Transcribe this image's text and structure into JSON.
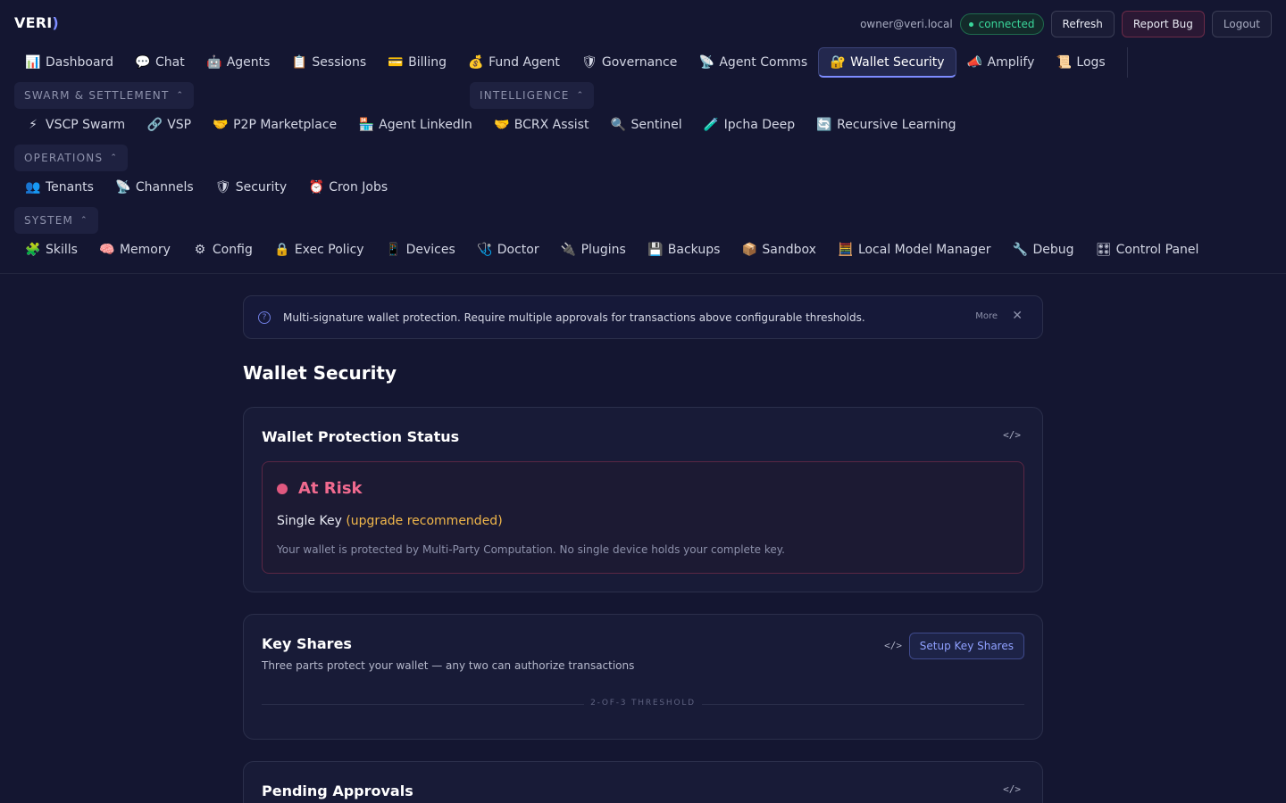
{
  "header": {
    "logo": "VERI",
    "logo_paren": ")",
    "user": "owner@veri.local",
    "status": "connected",
    "refresh_label": "Refresh",
    "report_bug_label": "Report Bug",
    "logout_label": "Logout"
  },
  "nav": {
    "main": [
      {
        "icon": "📊",
        "label": "Dashboard"
      },
      {
        "icon": "💬",
        "label": "Chat"
      },
      {
        "icon": "🤖",
        "label": "Agents"
      },
      {
        "icon": "📋",
        "label": "Sessions"
      },
      {
        "icon": "💳",
        "label": "Billing"
      },
      {
        "icon": "💰",
        "label": "Fund Agent"
      },
      {
        "icon": "🛡",
        "label": "Governance"
      },
      {
        "icon": "📡",
        "label": "Agent Comms"
      },
      {
        "icon": "🔐",
        "label": "Wallet Security"
      },
      {
        "icon": "📣",
        "label": "Amplify"
      },
      {
        "icon": "📜",
        "label": "Logs"
      }
    ],
    "active": "Wallet Security",
    "groups": {
      "swarm": "SWARM & SETTLEMENT",
      "intelligence": "INTELLIGENCE",
      "operations": "OPERATIONS",
      "system": "SYSTEM"
    },
    "swarm_intel": [
      {
        "icon": "⚡",
        "label": "VSCP Swarm"
      },
      {
        "icon": "🔗",
        "label": "VSP"
      },
      {
        "icon": "🤝",
        "label": "P2P Marketplace"
      },
      {
        "icon": "🏪",
        "label": "Agent LinkedIn"
      },
      {
        "icon": "🤝",
        "label": "BCRX Assist"
      },
      {
        "icon": "🔍",
        "label": "Sentinel"
      },
      {
        "icon": "🧪",
        "label": "Ipcha Deep"
      },
      {
        "icon": "🔄",
        "label": "Recursive Learning"
      }
    ],
    "operations": [
      {
        "icon": "👥",
        "label": "Tenants"
      },
      {
        "icon": "📡",
        "label": "Channels"
      },
      {
        "icon": "🛡",
        "label": "Security"
      },
      {
        "icon": "⏰",
        "label": "Cron Jobs"
      }
    ],
    "system": [
      {
        "icon": "🧩",
        "label": "Skills"
      },
      {
        "icon": "🧠",
        "label": "Memory"
      },
      {
        "icon": "⚙",
        "label": "Config"
      },
      {
        "icon": "🔒",
        "label": "Exec Policy"
      },
      {
        "icon": "📱",
        "label": "Devices"
      },
      {
        "icon": "🩺",
        "label": "Doctor"
      },
      {
        "icon": "🔌",
        "label": "Plugins"
      },
      {
        "icon": "💾",
        "label": "Backups"
      },
      {
        "icon": "📦",
        "label": "Sandbox"
      },
      {
        "icon": "🧮",
        "label": "Local Model Manager"
      },
      {
        "icon": "🔧",
        "label": "Debug"
      },
      {
        "icon": "🎛",
        "label": "Control Panel"
      }
    ]
  },
  "banner": {
    "text": "Multi-signature wallet protection. Require multiple approvals for transactions above configurable thresholds.",
    "more": "More"
  },
  "page": {
    "title": "Wallet Security"
  },
  "protection": {
    "title": "Wallet Protection Status",
    "status": "At Risk",
    "key_type": "Single Key",
    "recommendation": "(upgrade recommended)",
    "description": "Your wallet is protected by Multi-Party Computation. No single device holds your complete key."
  },
  "key_shares": {
    "title": "Key Shares",
    "subtitle": "Three parts protect your wallet — any two can authorize transactions",
    "setup_label": "Setup Key Shares",
    "threshold_label": "2-OF-3 THRESHOLD"
  },
  "approvals": {
    "title": "Pending Approvals"
  },
  "colors": {
    "background": "#141631",
    "accent": "#7d8cff",
    "risk": "#f06a8f",
    "warning": "#f2b84b",
    "connected": "#3ad79b"
  }
}
